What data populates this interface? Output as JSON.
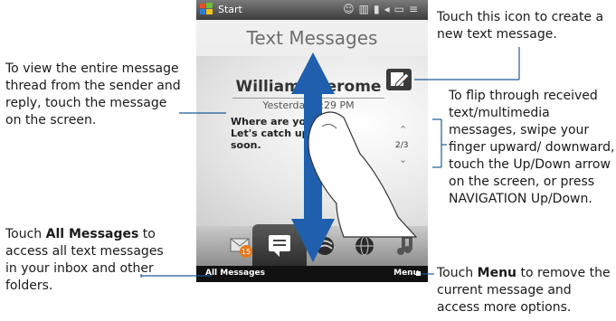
{
  "status_bar": {
    "start_label": "Start"
  },
  "screen_title": "Text Messages",
  "message": {
    "sender": "Williams, Jerome",
    "date": "Yesterday 2:29 PM",
    "text": "Where are you? Let's catch up soon."
  },
  "navigation": {
    "counter": "2/3",
    "up_glyph": "⌃",
    "down_glyph": "⌄"
  },
  "softkeys": {
    "left": "All Messages",
    "right": "Menu"
  },
  "tabs": {
    "messages_badge": "15"
  },
  "callouts": {
    "compose": "Touch this icon to create a new text message.",
    "thread": "To view the entire message thread from the sender and reply, touch the message on the screen.",
    "flip": "To flip through received text/multimedia messages, swipe your finger upward/ downward, touch the Up/Down arrow on the screen, or press NAVIGATION Up/Down.",
    "all_messages_prefix": "Touch ",
    "all_messages_bold": "All Messages",
    "all_messages_suffix": " to access all text messages in your inbox and other folders.",
    "menu_prefix": "Touch ",
    "menu_bold": "Menu",
    "menu_suffix": " to remove the current message and access more options."
  },
  "colors": {
    "callout_line": "#1f5a96",
    "arrow": "#1f5fae"
  }
}
